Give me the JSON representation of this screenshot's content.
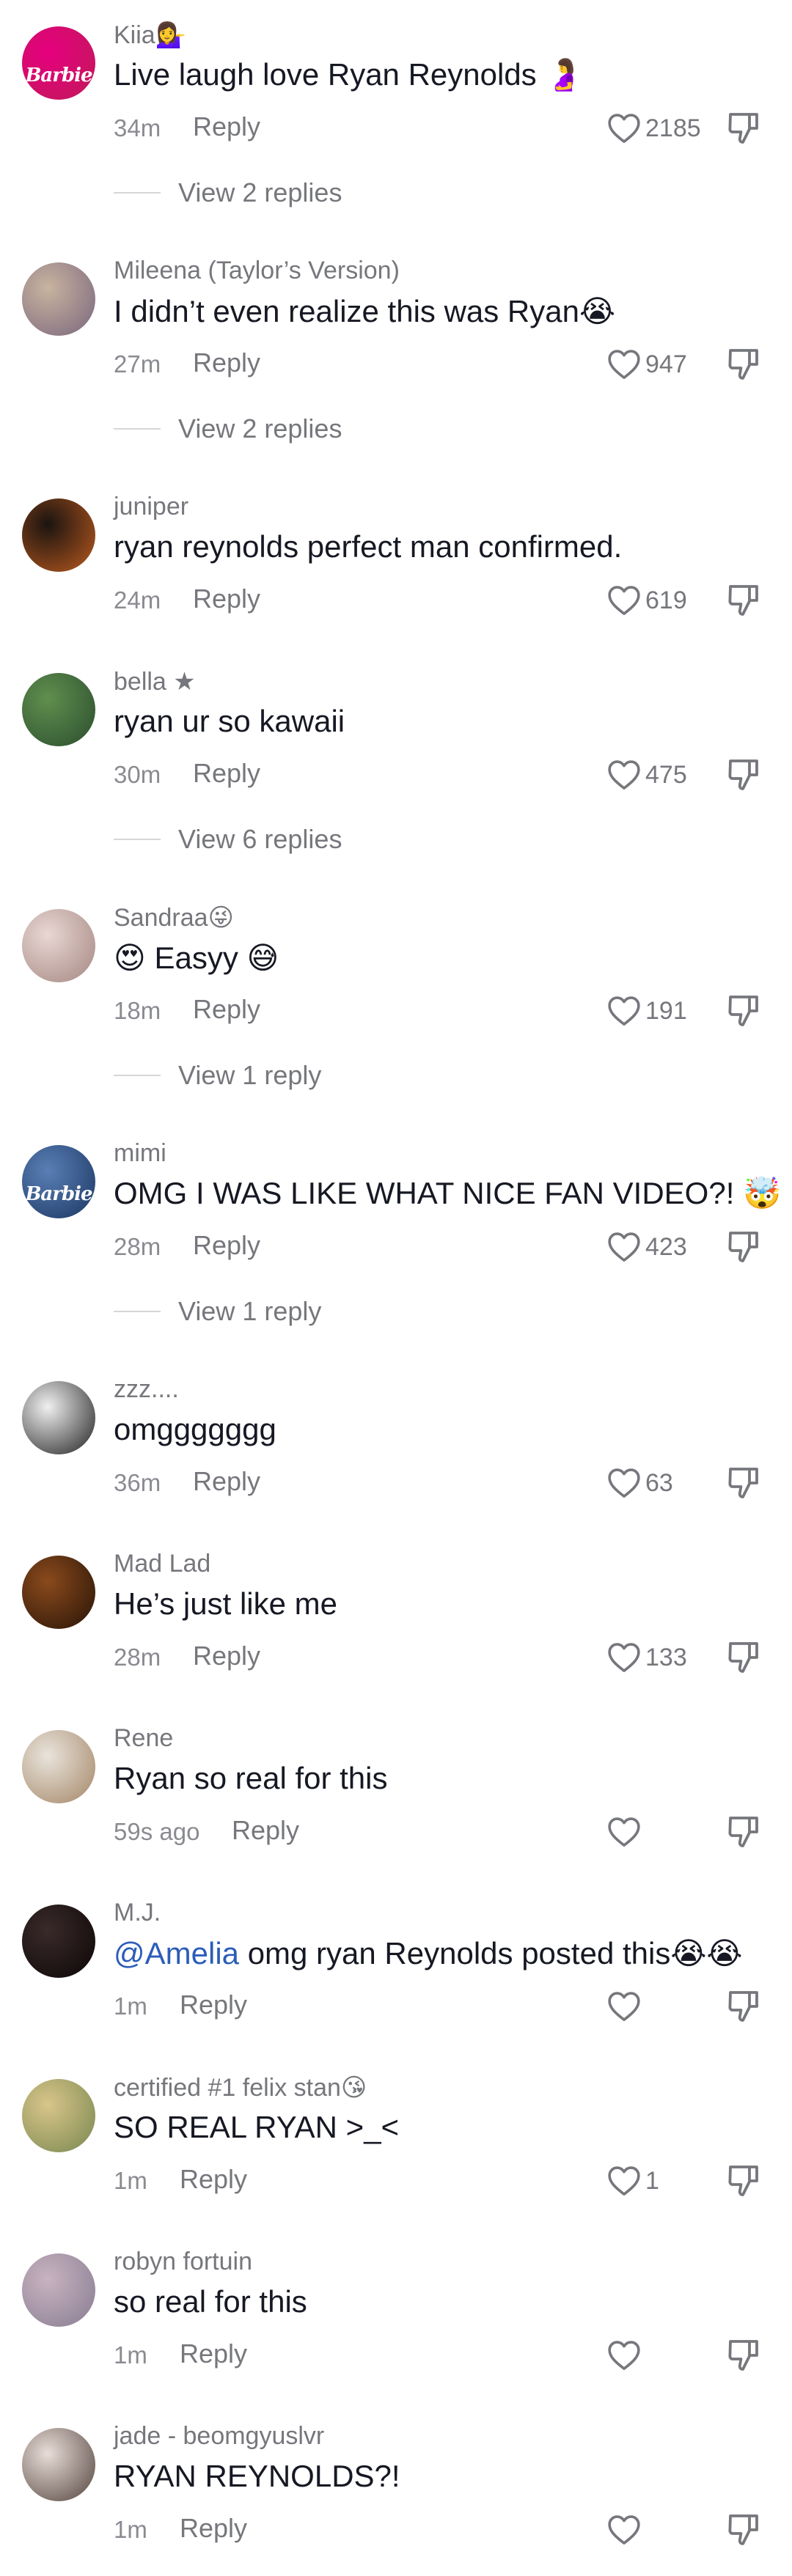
{
  "reply_label": "Reply",
  "comments": [
    {
      "username": "Kiia💁‍♀️",
      "text": "Live laugh love Ryan Reynolds 🤰",
      "time": "34m",
      "likes": "2185",
      "view_replies": "View 2 replies",
      "avatar_icon": "barbie-logo-avatar",
      "avatar_glyph": "Barbie",
      "avatar_colors": [
        "#e6007e",
        "#c2185b"
      ]
    },
    {
      "username": "Mileena (Taylor’s Version)",
      "text": "I didn’t even realize this was Ryan😭",
      "time": "27m",
      "likes": "947",
      "view_replies": "View 2 replies",
      "avatar_icon": "photo-avatar",
      "avatar_colors": [
        "#c9b3a0",
        "#7d6a7e"
      ]
    },
    {
      "username": "juniper",
      "text": "ryan reynolds perfect man confirmed.",
      "time": "24m",
      "likes": "619",
      "view_replies": "",
      "avatar_icon": "photo-avatar",
      "avatar_colors": [
        "#1a1410",
        "#b3561e"
      ]
    },
    {
      "username": "bella ★",
      "text": "ryan ur so kawaii",
      "time": "30m",
      "likes": "475",
      "view_replies": "View 6 replies",
      "avatar_icon": "photo-avatar",
      "avatar_colors": [
        "#5f8f4e",
        "#2e5030"
      ]
    },
    {
      "username": "Sandraa😜",
      "text": "😍 Easyy 😅",
      "time": "18m",
      "likes": "191",
      "view_replies": "View 1 reply",
      "avatar_icon": "photo-avatar",
      "avatar_colors": [
        "#e8d7d3",
        "#a88a85"
      ]
    },
    {
      "username": "mimi",
      "text": "OMG I WAS LIKE WHAT NICE FAN VIDEO?! 🤯",
      "time": "28m",
      "likes": "423",
      "view_replies": "View 1 reply",
      "avatar_icon": "barbie-logo-avatar",
      "avatar_glyph": "Barbie",
      "avatar_colors": [
        "#5a7fb5",
        "#1e3a66"
      ]
    },
    {
      "username": "zzz....",
      "text": "omggggggg",
      "time": "36m",
      "likes": "63",
      "view_replies": "",
      "avatar_icon": "photo-avatar",
      "avatar_colors": [
        "#f0f0f0",
        "#2a2a2a"
      ]
    },
    {
      "username": "Mad Lad",
      "text": "He’s just like me",
      "time": "28m",
      "likes": "133",
      "view_replies": "",
      "avatar_icon": "photo-avatar",
      "avatar_colors": [
        "#8a4a1c",
        "#2c1608"
      ]
    },
    {
      "username": "Rene",
      "text": "Ryan so real for this",
      "time": "59s ago",
      "likes": "",
      "view_replies": "",
      "avatar_icon": "photo-avatar",
      "avatar_colors": [
        "#e9e4dc",
        "#a78a6c"
      ]
    },
    {
      "username": "M.J.",
      "text": "omg ryan Reynolds posted this😭😭",
      "mention": "@Amelia",
      "time": "1m",
      "likes": "",
      "view_replies": "",
      "avatar_icon": "photo-avatar",
      "avatar_colors": [
        "#3a2a2a",
        "#0e0808"
      ]
    },
    {
      "username": "certified #1 felix stan😘",
      "text": "SO REAL RYAN >_<",
      "time": "1m",
      "likes": "1",
      "view_replies": "",
      "avatar_icon": "photo-avatar",
      "avatar_colors": [
        "#d9c58a",
        "#7c8a52"
      ]
    },
    {
      "username": "robyn fortuin",
      "text": "so real for this",
      "time": "1m",
      "likes": "",
      "view_replies": "",
      "avatar_icon": "photo-avatar",
      "avatar_colors": [
        "#c8b3c0",
        "#8a7f94"
      ]
    },
    {
      "username": "jade - beomgyuslvr",
      "text": "RYAN REYNOLDS?!",
      "time": "1m",
      "likes": "",
      "view_replies": "",
      "avatar_icon": "photo-avatar",
      "avatar_colors": [
        "#e8ddd8",
        "#5a4a44"
      ]
    }
  ]
}
